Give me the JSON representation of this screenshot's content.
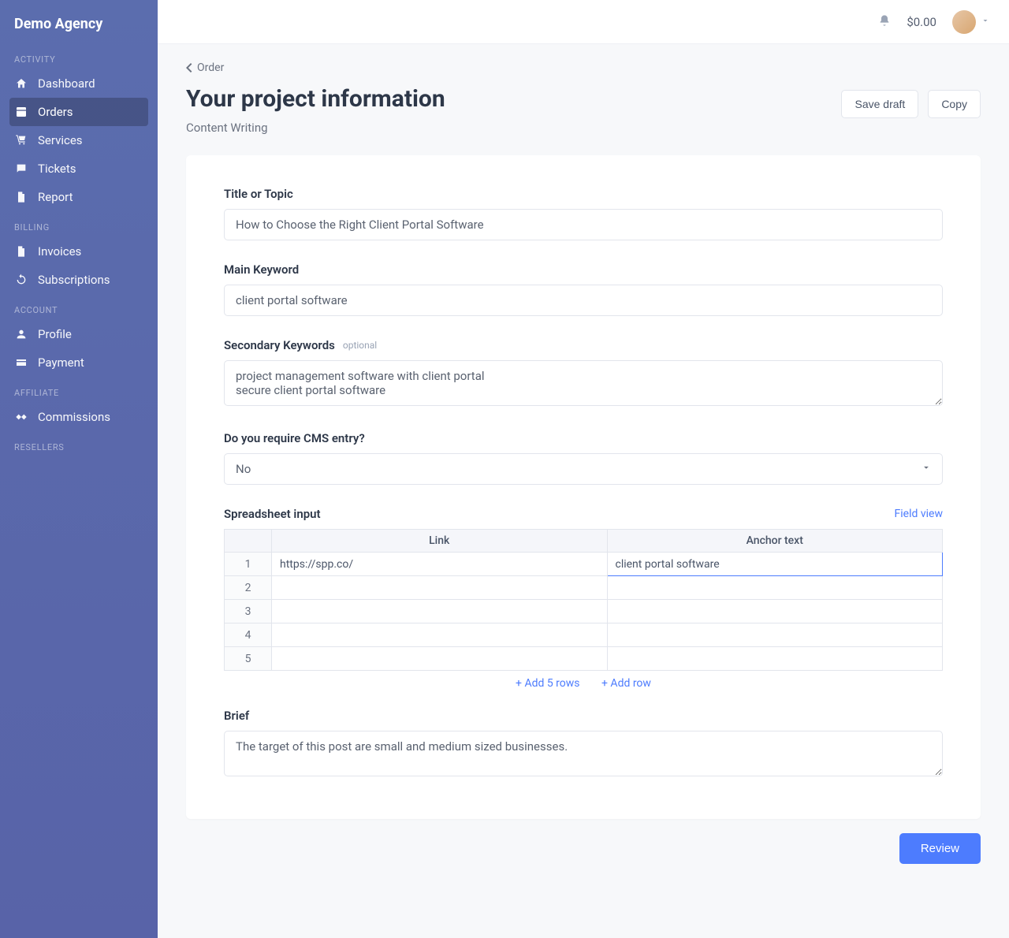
{
  "brand": "Demo Agency",
  "topbar": {
    "balance": "$0.00"
  },
  "sidebar": {
    "sections": [
      {
        "title": "ACTIVITY",
        "items": [
          {
            "label": "Dashboard",
            "icon": "home",
            "active": false
          },
          {
            "label": "Orders",
            "icon": "dashboard",
            "active": true
          },
          {
            "label": "Services",
            "icon": "cart",
            "active": false
          },
          {
            "label": "Tickets",
            "icon": "chat",
            "active": false
          },
          {
            "label": "Report",
            "icon": "file",
            "active": false
          }
        ]
      },
      {
        "title": "BILLING",
        "items": [
          {
            "label": "Invoices",
            "icon": "file",
            "active": false
          },
          {
            "label": "Subscriptions",
            "icon": "refresh",
            "active": false
          }
        ]
      },
      {
        "title": "ACCOUNT",
        "items": [
          {
            "label": "Profile",
            "icon": "user",
            "active": false
          },
          {
            "label": "Payment",
            "icon": "card",
            "active": false
          }
        ]
      },
      {
        "title": "AFFILIATE",
        "items": [
          {
            "label": "Commissions",
            "icon": "handshake",
            "active": false
          }
        ]
      },
      {
        "title": "RESELLERS",
        "items": []
      }
    ]
  },
  "breadcrumb": {
    "label": "Order"
  },
  "page": {
    "title": "Your project information",
    "subtitle": "Content Writing",
    "actions": {
      "save_draft": "Save draft",
      "copy": "Copy"
    }
  },
  "form": {
    "title_label": "Title or Topic",
    "title_value": "How to Choose the Right Client Portal Software",
    "keyword_label": "Main Keyword",
    "keyword_value": "client portal software",
    "secondary_label": "Secondary Keywords",
    "optional_text": "optional",
    "secondary_value": "project management software with client portal\nsecure client portal software",
    "cms_label": "Do you require CMS entry?",
    "cms_value": "No",
    "spreadsheet_label": "Spreadsheet input",
    "field_view": "Field view",
    "sheet": {
      "header_link": "Link",
      "header_anchor": "Anchor text",
      "rows": [
        {
          "n": "1",
          "link": "https://spp.co/",
          "anchor": "client portal software"
        },
        {
          "n": "2",
          "link": "",
          "anchor": ""
        },
        {
          "n": "3",
          "link": "",
          "anchor": ""
        },
        {
          "n": "4",
          "link": "",
          "anchor": ""
        },
        {
          "n": "5",
          "link": "",
          "anchor": ""
        }
      ],
      "add5": "+ Add 5 rows",
      "add1": "+ Add row"
    },
    "brief_label": "Brief",
    "brief_value": "The target of this post are small and medium sized businesses."
  },
  "footer": {
    "review": "Review"
  }
}
